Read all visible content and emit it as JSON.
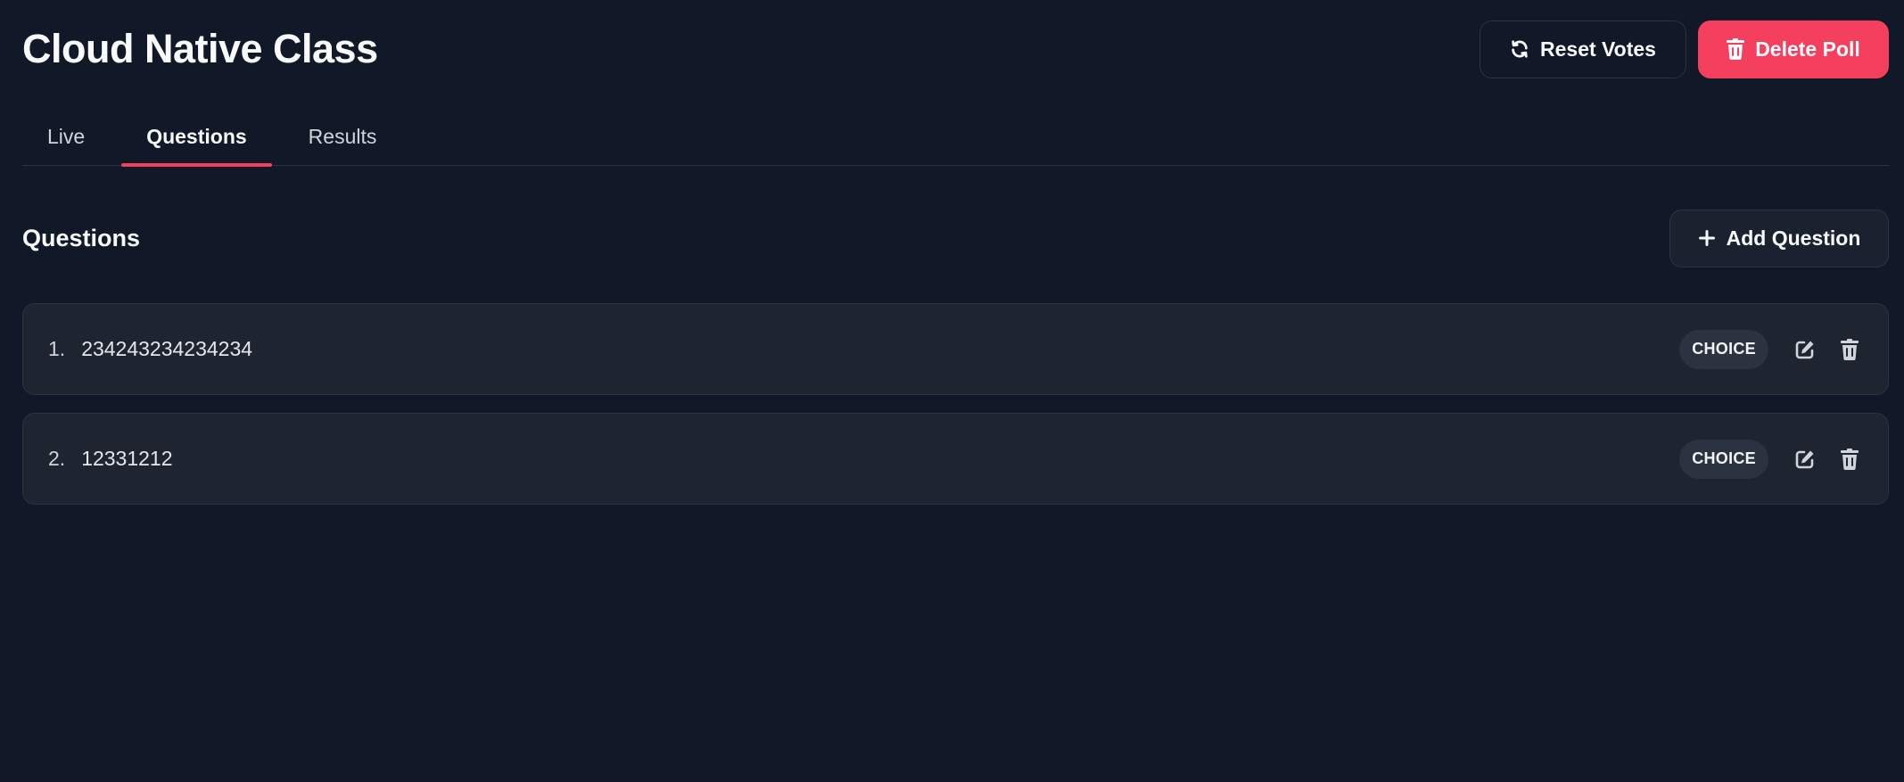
{
  "header": {
    "title": "Cloud Native Class",
    "reset_votes_label": "Reset Votes",
    "delete_poll_label": "Delete Poll"
  },
  "tabs": [
    {
      "label": "Live",
      "active": false
    },
    {
      "label": "Questions",
      "active": true
    },
    {
      "label": "Results",
      "active": false
    }
  ],
  "questions_section": {
    "title": "Questions",
    "add_question_label": "Add Question",
    "items": [
      {
        "number": "1.",
        "text": "234243234234234",
        "type": "CHOICE"
      },
      {
        "number": "2.",
        "text": "12331212",
        "type": "CHOICE"
      }
    ]
  },
  "icons": {
    "reset": "refresh-icon",
    "delete": "trash-icon",
    "add": "plus-icon",
    "edit": "edit-icon"
  },
  "colors": {
    "background": "#111827",
    "card": "#1e2430",
    "border": "#2b3443",
    "accent": "#f43f5e",
    "badge": "#2b3240"
  }
}
